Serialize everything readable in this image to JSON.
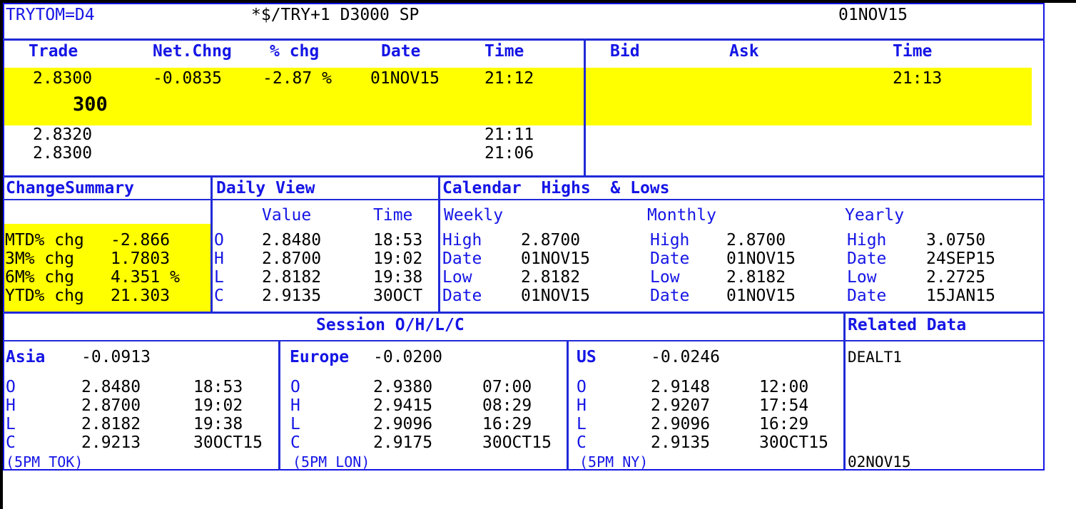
{
  "header": {
    "ric": "TRYTOM=D4",
    "description": "*$/TRY+1 D3000 SP",
    "date": "01NOV15"
  },
  "quote": {
    "headers": {
      "trade": "Trade",
      "net_chng": "Net.Chng",
      "pct_chg": "% chg",
      "date": "Date",
      "time": "Time",
      "bid": "Bid",
      "ask": "Ask",
      "time2": "Time"
    },
    "trade": "2.8300",
    "net_chng": "-0.0835",
    "pct_chg": "-2.87 %",
    "date": "01NOV15",
    "time": "21:12",
    "volume": "300",
    "bid_time": "21:13",
    "history": [
      {
        "price": "2.8320",
        "time": "21:11"
      },
      {
        "price": "2.8300",
        "time": "21:06"
      }
    ]
  },
  "change_summary": {
    "title": "ChangeSummary",
    "rows": [
      {
        "label": "MTD% chg",
        "value": "-2.866"
      },
      {
        "label": "3M% chg",
        "value": "1.7803"
      },
      {
        "label": "6M% chg",
        "value": "4.351 %"
      },
      {
        "label": "YTD% chg",
        "value": "21.303"
      }
    ]
  },
  "daily_view": {
    "title": "Daily View",
    "value_header": "Value",
    "time_header": "Time",
    "rows": [
      {
        "label": "O",
        "value": "2.8480",
        "time": "18:53"
      },
      {
        "label": "H",
        "value": "2.8700",
        "time": "19:02"
      },
      {
        "label": "L",
        "value": "2.8182",
        "time": "19:38"
      },
      {
        "label": "C",
        "value": "2.9135",
        "time": "30OCT"
      }
    ]
  },
  "calendar": {
    "title": "Calendar  Highs  & Lows",
    "weekly": {
      "title": "Weekly",
      "high_label": "High",
      "high": "2.8700",
      "date_label": "Date",
      "high_date": "01NOV15",
      "low_label": "Low",
      "low": "2.8182",
      "low_date": "01NOV15"
    },
    "monthly": {
      "title": "Monthly",
      "high_label": "High",
      "high": "2.8700",
      "date_label": "Date",
      "high_date": "01NOV15",
      "low_label": "Low",
      "low": "2.8182",
      "low_date": "01NOV15"
    },
    "yearly": {
      "title": "Yearly",
      "high_label": "High",
      "high": "3.0750",
      "date_label": "Date",
      "high_date": "24SEP15",
      "low_label": "Low",
      "low": "2.2725",
      "low_date": "15JAN15"
    }
  },
  "sessions": {
    "title": "Session O/H/L/C",
    "asia": {
      "name": "Asia",
      "change": "-0.0913",
      "o": "2.8480",
      "o_time": "18:53",
      "h": "2.8700",
      "h_time": "19:02",
      "l": "2.8182",
      "l_time": "19:38",
      "c": "2.9213",
      "c_time": "30OCT15",
      "footer": "(5PM TOK)"
    },
    "europe": {
      "name": "Europe",
      "change": "-0.0200",
      "o": "2.9380",
      "o_time": "07:00",
      "h": "2.9415",
      "h_time": "08:29",
      "l": "2.9096",
      "l_time": "16:29",
      "c": "2.9175",
      "c_time": "30OCT15",
      "footer": "(5PM LON)"
    },
    "us": {
      "name": "US",
      "change": "-0.0246",
      "o": "2.9148",
      "o_time": "12:00",
      "h": "2.9207",
      "h_time": "17:54",
      "l": "2.9096",
      "l_time": "16:29",
      "c": "2.9135",
      "c_time": "30OCT15",
      "footer": "(5PM NY)"
    },
    "labels": {
      "o": "O",
      "h": "H",
      "l": "L",
      "c": "C"
    }
  },
  "related": {
    "title": "Related Data",
    "item": "DEALT1",
    "date": "02NOV15"
  },
  "colors": {
    "frame": "#1515e6",
    "highlight": "#ffff00"
  }
}
